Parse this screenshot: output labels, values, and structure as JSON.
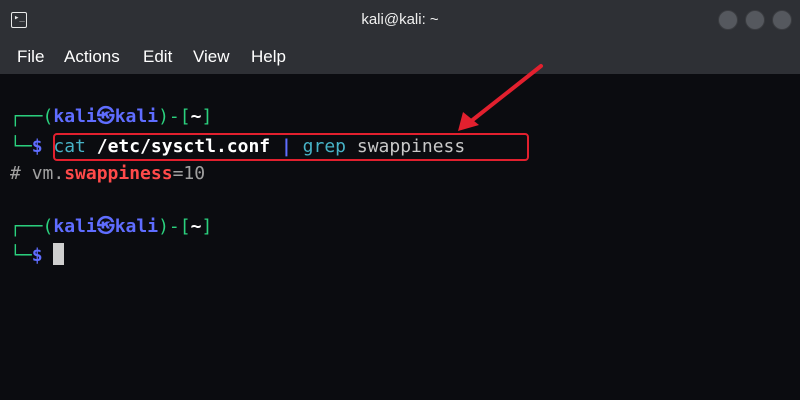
{
  "window": {
    "title": "kali@kali: ~",
    "app_icon_glyph": "▸_",
    "icon_names": [
      "terminal-icon",
      "minimize-button",
      "maximize-button",
      "close-button"
    ]
  },
  "menu": {
    "items": [
      "File",
      "Actions",
      "Edit",
      "View",
      "Help"
    ]
  },
  "terminal": {
    "prompt1": {
      "corner": "┌──",
      "open": "(",
      "user": "kali",
      "at": "㉿",
      "host": "kali",
      "close": ")-[",
      "dir": "~",
      "end": "]"
    },
    "command_line": {
      "corner": "└─",
      "dollar": "$",
      "cmd": "cat",
      "path": "/etc/sysctl.conf",
      "pipe": "|",
      "cmd2": "grep",
      "arg": "swappiness"
    },
    "output": {
      "hash": "#",
      "prefix": "vm.",
      "key": "swappiness",
      "suffix": "=10"
    },
    "prompt2": {
      "corner": "┌──",
      "open": "(",
      "user": "kali",
      "at": "㉿",
      "host": "kali",
      "close": ")-[",
      "dir": "~",
      "end": "]"
    },
    "input_line": {
      "corner": "└─",
      "dollar": "$"
    }
  },
  "colors": {
    "background": "#0b0c10",
    "titlebar": "#2e3035",
    "prompt_green": "#2bd17e",
    "prompt_blue": "#5f6dff",
    "command_cyan": "#47b3c7",
    "highlight_red": "#e2202e",
    "match_red": "#ff4a4a"
  }
}
